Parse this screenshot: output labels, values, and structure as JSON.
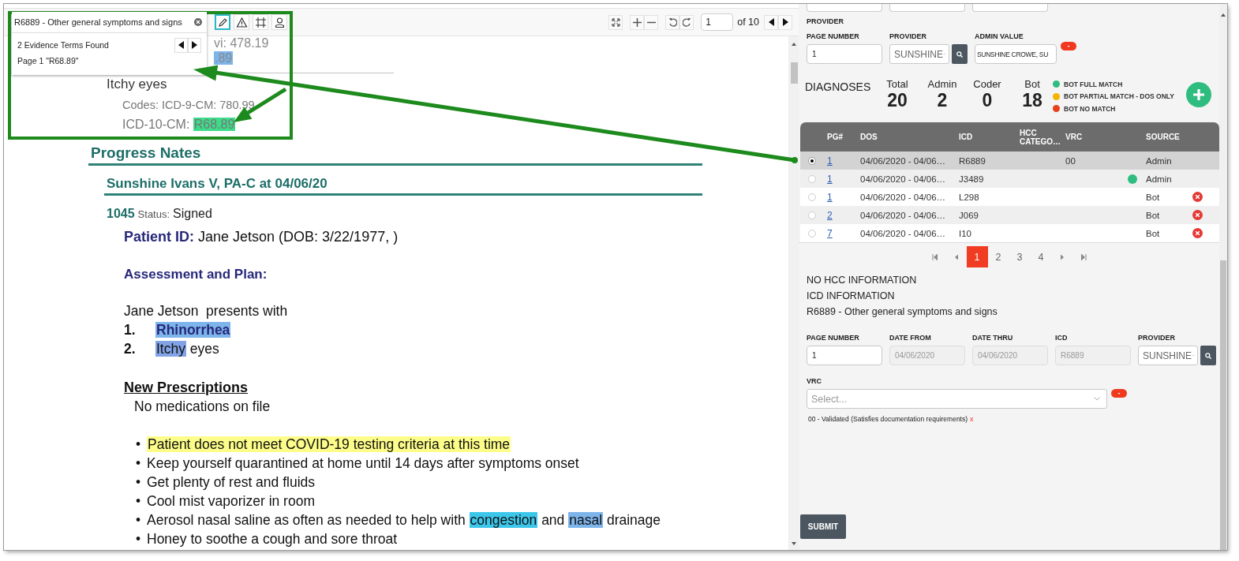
{
  "viewer": {
    "page": "1",
    "page_total": "of 10"
  },
  "document": {
    "lines": [
      {
        "kind": "fragment",
        "parts": [
          {
            "text": "vi: 478.19"
          }
        ]
      },
      {
        "kind": "fragment-highlight",
        "parts": [
          {
            "text": ".89",
            "color": "#7db4ea"
          }
        ]
      },
      {
        "kind": "term",
        "parts": [
          {
            "text": "Itchy eyes"
          }
        ]
      },
      {
        "kind": "codes",
        "parts": [
          {
            "text": "Codes: ICD-9-CM: 780.99"
          }
        ]
      },
      {
        "kind": "codes-sub",
        "parts": [
          {
            "text": "ICD-10-CM: "
          },
          {
            "text": "R68.89",
            "color": "#3ddc8a"
          }
        ]
      },
      {
        "kind": "heading",
        "parts": [
          {
            "text": "Progress Nates"
          }
        ]
      },
      {
        "kind": "subheading",
        "parts": [
          {
            "text": "Sunshine Ivans V, PA-C at 04/06/20"
          }
        ]
      },
      {
        "kind": "status",
        "id": "1045",
        "label": "Status:",
        "value": "Signed"
      },
      {
        "kind": "patient",
        "parts": [
          {
            "text": "Patient ID:",
            "kind": "strong"
          },
          {
            "text": " Jane Jetson (DOB: 3/22/1977, )"
          }
        ]
      },
      {
        "kind": "section",
        "parts": [
          {
            "text": "Assessment and Plan:"
          }
        ]
      },
      {
        "kind": "intro",
        "parts": [
          {
            "text": "Jane Jetson  presents with"
          }
        ]
      },
      {
        "kind": "numbered",
        "marker": "1.",
        "parts": [
          {
            "text": "Rhinorrhea",
            "kind": "strong",
            "color": "#7db4ea"
          }
        ]
      },
      {
        "kind": "numbered",
        "marker": "2.",
        "parts": [
          {
            "text": "Itchy",
            "color": "#82a4e6"
          },
          {
            "text": " eyes"
          }
        ]
      },
      {
        "kind": "underlined",
        "parts": [
          {
            "text": "New Prescriptions"
          }
        ]
      },
      {
        "kind": "note",
        "parts": [
          {
            "text": "No medications on file"
          }
        ]
      },
      {
        "kind": "bullet",
        "marker": "•",
        "parts": [
          {
            "text": "Patient does not meet COVID-19 testing criteria at this time",
            "color": "#fdfd8a"
          }
        ]
      },
      {
        "kind": "bullet",
        "marker": "•",
        "parts": [
          {
            "text": "Keep yourself quarantined at home until 14 days after symptoms onset"
          }
        ]
      },
      {
        "kind": "bullet",
        "marker": "•",
        "parts": [
          {
            "text": "Get plenty of rest and fluids"
          }
        ]
      },
      {
        "kind": "bullet",
        "marker": "•",
        "parts": [
          {
            "text": "Cool mist vaporizer in room"
          }
        ]
      },
      {
        "kind": "bullet",
        "marker": "•",
        "parts": [
          {
            "text": "Aerosol nasal saline as often as needed to help with "
          },
          {
            "text": "congestion",
            "color": "#3cc6ea"
          },
          {
            "text": " and "
          },
          {
            "text": "nasal",
            "color": "#7db4ea"
          },
          {
            "text": " drainage"
          }
        ]
      },
      {
        "kind": "bullet",
        "marker": "•",
        "parts": [
          {
            "text": "Honey to soothe a cough and sore throat"
          }
        ]
      }
    ]
  },
  "search": {
    "query": "R6889 - Other general symptoms and signs",
    "summary": "2 Evidence Terms Found",
    "result": "Page 1 \"R68.89\"",
    "tools": [
      {
        "kind": "pencil",
        "selected": true
      },
      {
        "kind": "warning",
        "selected": false
      },
      {
        "kind": "frame",
        "selected": false
      },
      {
        "kind": "person",
        "selected": false
      }
    ]
  },
  "panel": {
    "provider_heading": "PROVIDER",
    "admin_fields": [
      {
        "kind": "text",
        "label": "PAGE NUMBER",
        "value": "1",
        "disabled": false
      },
      {
        "kind": "select",
        "label": "PROVIDER",
        "value": "SUNSHINE",
        "disabled": false
      },
      {
        "kind": "text",
        "label": "ADMIN VALUE",
        "value": "SUNSHINE CROWE, SU",
        "disabled": false
      }
    ],
    "admin_remove": "-",
    "diagnoses": {
      "title": "DIAGNOSES",
      "stats": [
        {
          "label": "Total",
          "value": "20"
        },
        {
          "label": "Admin",
          "value": "2"
        },
        {
          "label": "Coder",
          "value": "0"
        },
        {
          "label": "Bot",
          "value": "18"
        }
      ],
      "legend": [
        {
          "label": "BOT FULL MATCH",
          "color": "#2ebd7f"
        },
        {
          "label": "BOT PARTIAL MATCH - DOS ONLY",
          "color": "#f5b400"
        },
        {
          "label": "BOT NO MATCH",
          "color": "#e8401c"
        }
      ]
    },
    "table": {
      "columns": [
        "PG#",
        "DOS",
        "ICD",
        "HCC CATEGO…",
        "VRC",
        "SOURCE"
      ],
      "rows": [
        {
          "selected": true,
          "page": "1",
          "dos": "04/06/2020 - 04/06…",
          "icd": "R6889",
          "vrc": "00",
          "source": "Admin",
          "removable": false
        },
        {
          "selected": false,
          "page": "1",
          "dos": "04/06/2020 - 04/06…",
          "icd": "J3489",
          "color": "#2ebd7f",
          "source": "Admin",
          "removable": false
        },
        {
          "selected": false,
          "page": "1",
          "dos": "04/06/2020 - 04/06…",
          "icd": "L298",
          "source": "Bot",
          "removable": true
        },
        {
          "selected": false,
          "page": "2",
          "dos": "04/06/2020 - 04/06…",
          "icd": "J069",
          "source": "Bot",
          "removable": true
        },
        {
          "selected": false,
          "page": "7",
          "dos": "04/06/2020 - 04/06…",
          "icd": "I10",
          "source": "Bot",
          "removable": true
        }
      ]
    },
    "pagination": [
      {
        "label": "1",
        "selected": true
      },
      {
        "label": "2",
        "selected": false
      },
      {
        "label": "3",
        "selected": false
      },
      {
        "label": "4",
        "selected": false
      }
    ],
    "info": [
      "NO HCC INFORMATION",
      "ICD INFORMATION",
      "R6889 - Other general symptoms and signs"
    ],
    "detail_fields": [
      {
        "kind": "text",
        "label": "PAGE NUMBER",
        "value": "1",
        "disabled": false
      },
      {
        "kind": "text",
        "label": "DATE FROM",
        "value": "04/06/2020",
        "disabled": true
      },
      {
        "kind": "text",
        "label": "DATE THRU",
        "value": "04/06/2020",
        "disabled": true
      },
      {
        "kind": "text",
        "label": "ICD",
        "value": "R6889",
        "disabled": true
      },
      {
        "kind": "select",
        "label": "PROVIDER",
        "value": "SUNSHINE",
        "disabled": false
      }
    ],
    "vrc": {
      "label": "VRC",
      "placeholder": "Select...",
      "remove": "-",
      "chosen": "00 - Validated (Satisfies documentation requirements)",
      "clear": "x"
    },
    "submit": "SUBMIT"
  }
}
